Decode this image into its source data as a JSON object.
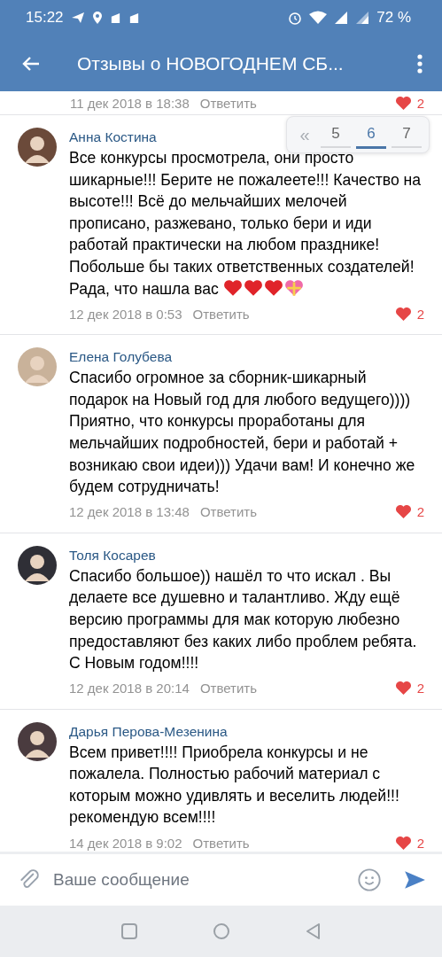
{
  "status_bar": {
    "time": "15:22",
    "battery": "72 %"
  },
  "header": {
    "title": "Отзывы о НОВОГОДНЕМ СБ..."
  },
  "pagination": {
    "first": "«",
    "pages": [
      {
        "label": "5",
        "selected": false
      },
      {
        "label": "6",
        "selected": true
      },
      {
        "label": "7",
        "selected": false
      }
    ]
  },
  "partial_comment": {
    "date": "11 дек 2018 в 18:38",
    "reply": "Ответить",
    "likes": "2"
  },
  "comments": [
    {
      "author": "Анна Костина",
      "text": "Все конкурсы просмотрела, они просто шикарные!!! Берите не пожалеете!!! Качество на высоте!!! Всё до мельчайших мелочей прописано, разжевано, только бери и иди работай практически на любом празднике! Побольше бы таких ответственных создателей! Рада, что нашла вас",
      "date": "12 дек 2018 в 0:53",
      "reply": "Ответить",
      "likes": "2",
      "liked": true
    },
    {
      "author": "Елена Голубева",
      "text": "Спасибо огромное за сборник-шикарный подарок на Новый год для любого ведущего)))) Приятно, что конкурсы проработаны для мельчайших подробностей, бери и работай + возникаю свои идеи))) Удачи вам! И конечно же будем сотрудничать!",
      "date": "12 дек 2018 в 13:48",
      "reply": "Ответить",
      "likes": "2",
      "liked": true
    },
    {
      "author": "Толя Косарев",
      "text": "Спасибо большое)) нашёл то что искал . Вы делаете все душевно и талантливо. Жду ещё версию программы для мак которую любезно предоставляют без каких либо проблем ребята. С Новым годом!!!!",
      "date": "12 дек 2018 в 20:14",
      "reply": "Ответить",
      "likes": "2",
      "liked": true
    },
    {
      "author": "Дарья Перова-Мезенина",
      "text": "Всем привет!!!! Приобрела конкурсы и не пожалела. Полностью рабочий материал с которым можно удивлять и веселить людей!!! рекомендую всем!!!!",
      "date": "14 дек 2018 в 9:02",
      "reply": "Ответить",
      "likes": "2",
      "liked": true
    }
  ],
  "composer": {
    "placeholder": "Ваше сообщение"
  }
}
